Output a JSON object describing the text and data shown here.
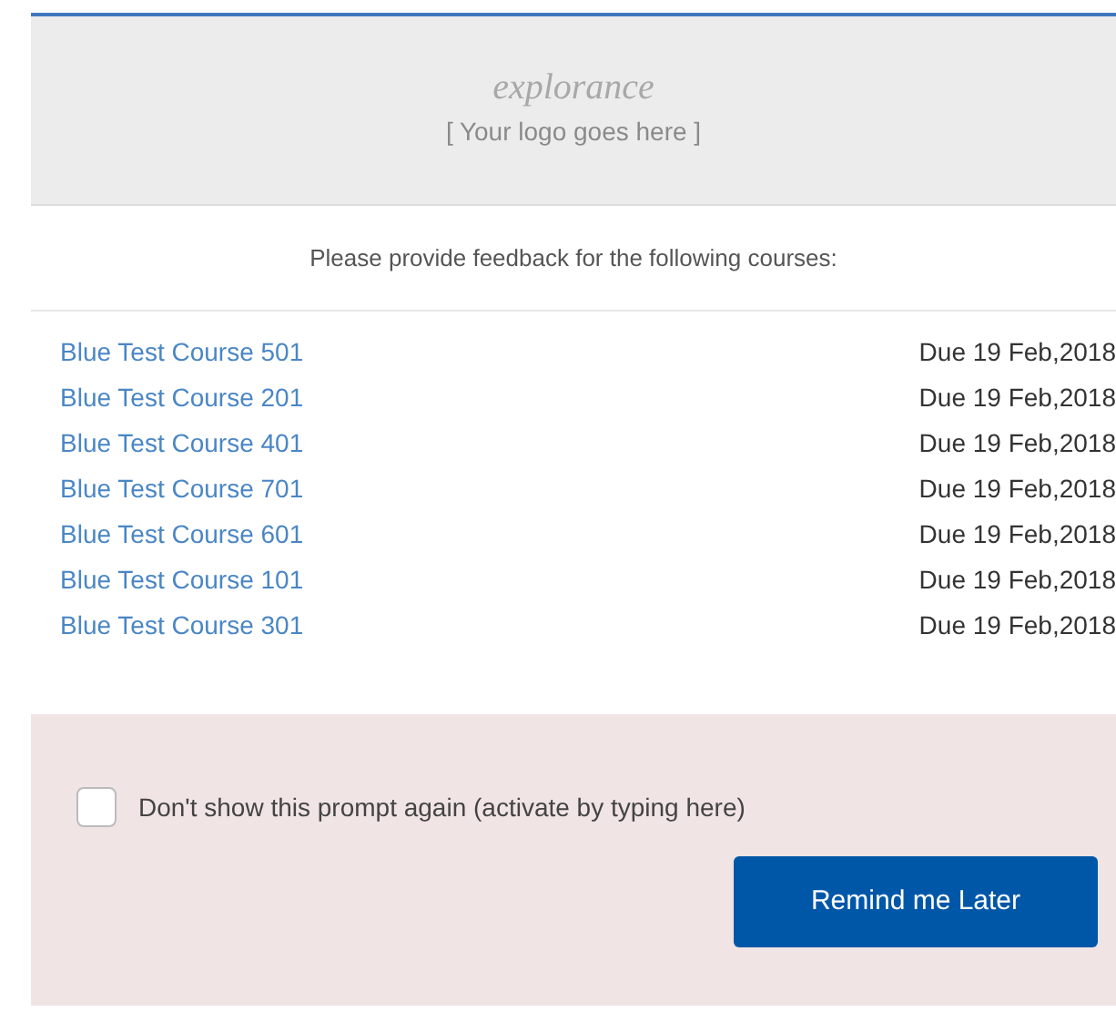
{
  "header": {
    "logo": "explorance",
    "logo_note": "[ Your logo goes here ]"
  },
  "prompt": "Please provide feedback for the following courses:",
  "courses": [
    {
      "name": "Blue Test Course 501",
      "due": "Due 19 Feb,2018"
    },
    {
      "name": "Blue Test Course 201",
      "due": "Due 19 Feb,2018"
    },
    {
      "name": "Blue Test Course 401",
      "due": "Due 19 Feb,2018"
    },
    {
      "name": "Blue Test Course 701",
      "due": "Due 19 Feb,2018"
    },
    {
      "name": "Blue Test Course 601",
      "due": "Due 19 Feb,2018"
    },
    {
      "name": "Blue Test Course 101",
      "due": "Due 19 Feb,2018"
    },
    {
      "name": "Blue Test Course 301",
      "due": "Due 19 Feb,2018"
    }
  ],
  "dont_show": {
    "label": "Don't show this prompt again (activate by typing here)",
    "checked": false
  },
  "buttons": [
    "Remind me Later"
  ]
}
